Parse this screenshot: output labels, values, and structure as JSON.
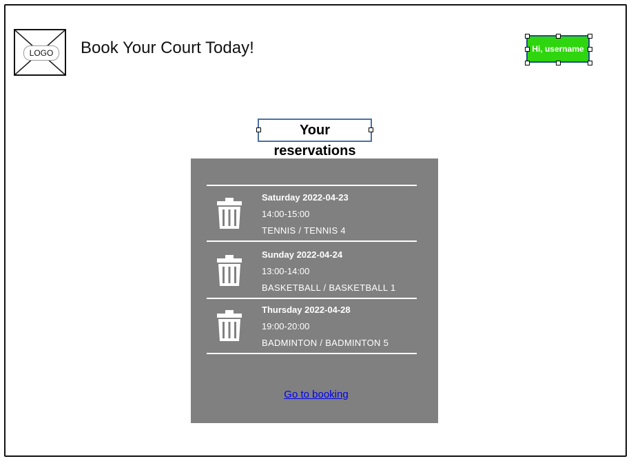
{
  "header": {
    "logo_label": "LOGO",
    "title": "Book Your Court Today!",
    "user_button_label": "Hi, username"
  },
  "main": {
    "section_title": "Your reservations",
    "reservations": [
      {
        "date": "Saturday 2022-04-23",
        "time": "14:00-15:00",
        "court": "TENNIS / TENNIS 4"
      },
      {
        "date": "Sunday 2022-04-24",
        "time": "13:00-14:00",
        "court": "BASKETBALL / BASKETBALL 1"
      },
      {
        "date": "Thursday 2022-04-28",
        "time": "19:00-20:00",
        "court": "BADMINTON / BADMINTON 5"
      }
    ],
    "goto_booking_label": "Go to booking"
  },
  "colors": {
    "user_button": "#2fd60f",
    "panel": "#808080",
    "link": "#0000ee"
  },
  "icons": {
    "reservation_delete": "trash-icon",
    "logo": "logo-placeholder-icon"
  }
}
